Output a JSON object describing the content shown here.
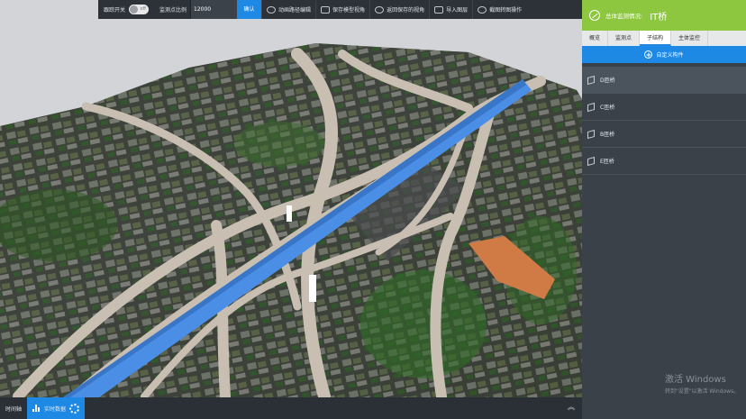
{
  "toolbar": {
    "follow_label": "跟踪开关",
    "toggle_state": "off",
    "scale_label": "监测点比例",
    "scale_value": "12000",
    "confirm_label": "确认",
    "buttons": [
      "动画路径编辑",
      "保存模型视角",
      "返回保存的视角",
      "导入图层",
      "截图转图操作"
    ]
  },
  "bottom": {
    "timeline_label": "时间轴",
    "realtime_label": "实时数据"
  },
  "panel": {
    "title": "总体监测情况:",
    "value": "IT桥",
    "tabs": [
      "概览",
      "监测点",
      "子结构",
      "主体监控"
    ],
    "active_tab": "子结构",
    "add_label": "自定义构件",
    "items": [
      "D匝桥",
      "C匝桥",
      "B匝桥",
      "E匝桥"
    ]
  },
  "watermark": {
    "line1": "激活 Windows",
    "line2": "转到\"设置\"以激活 Windows。"
  },
  "colors": {
    "accent": "#1e88e5",
    "brand_green": "#8dc63f",
    "panel_bg": "#3a4149",
    "highlight_bridge": "#4a8ee6"
  }
}
